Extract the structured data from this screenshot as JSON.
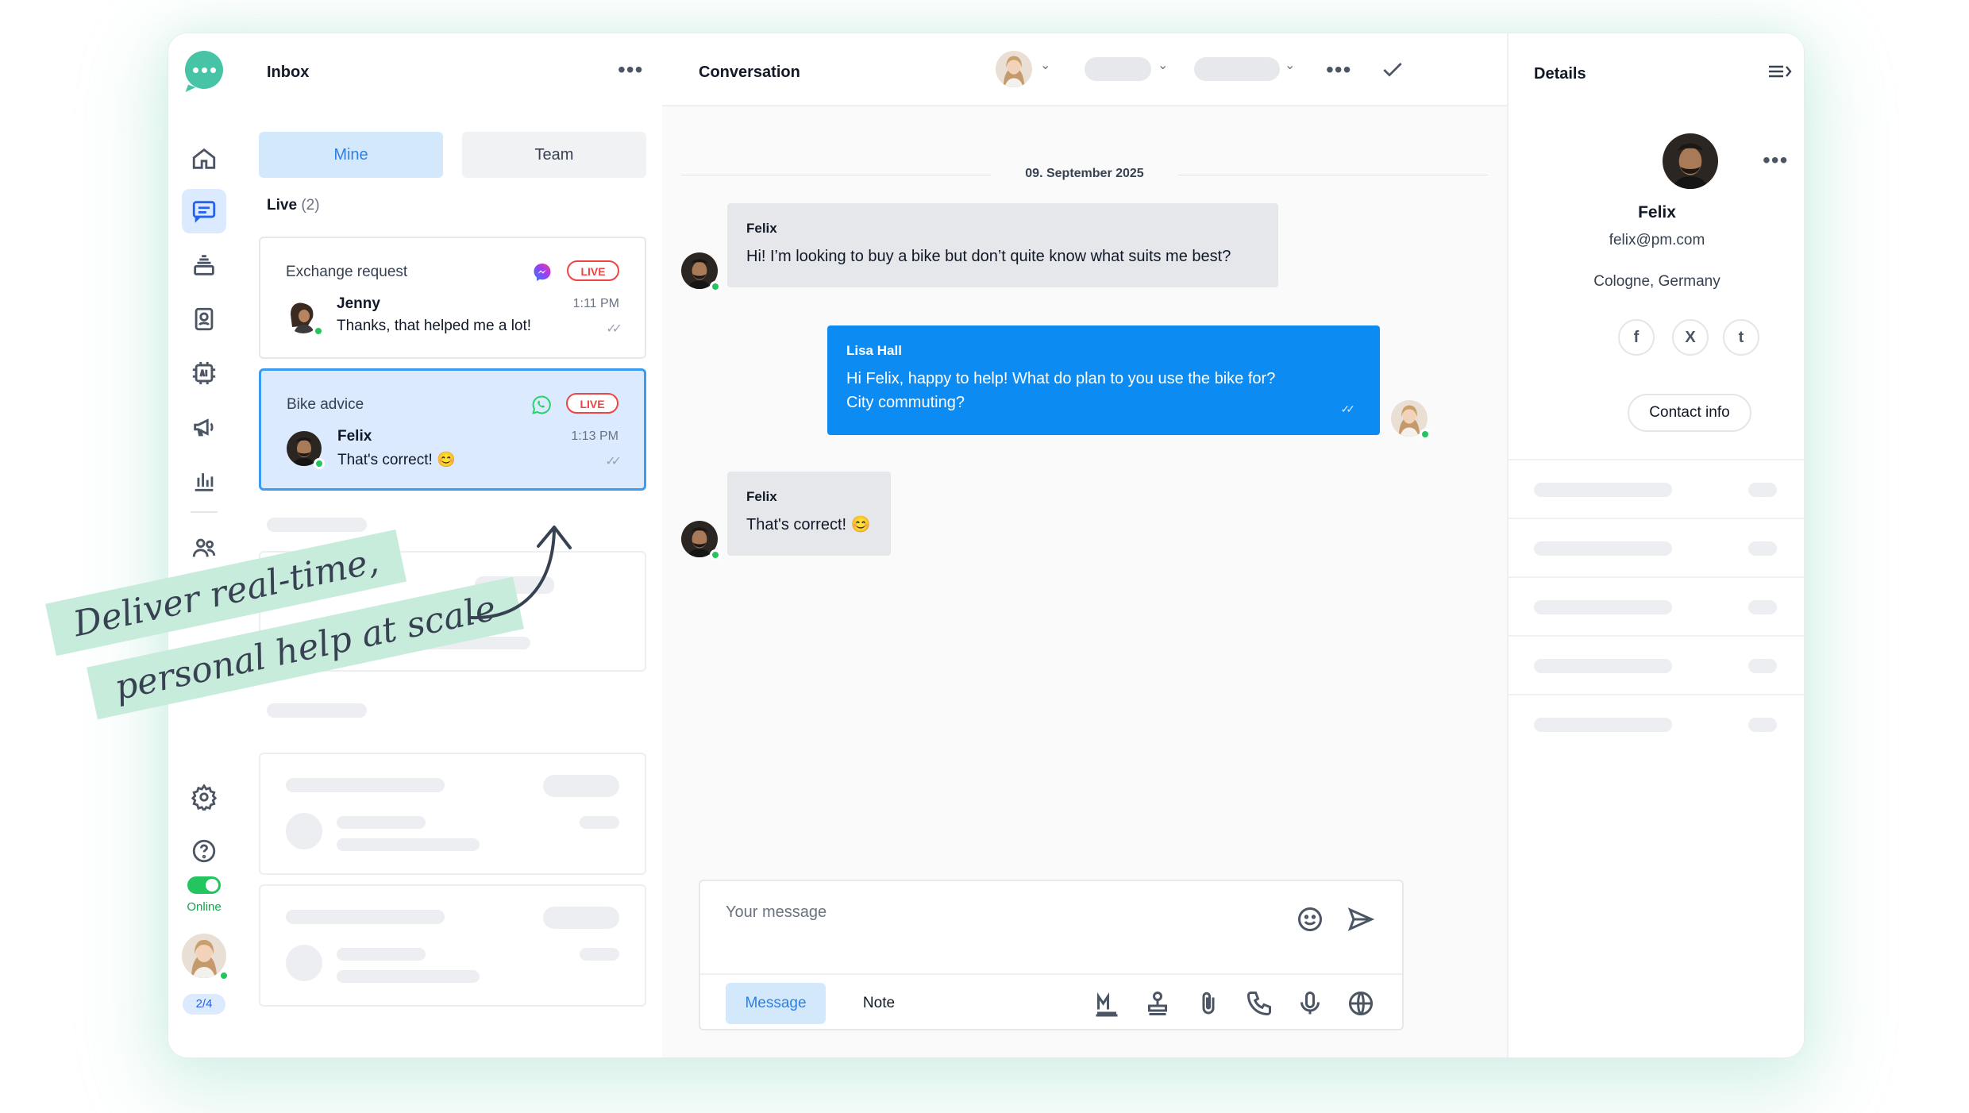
{
  "nav": {
    "items": [
      "home-icon",
      "conversations-icon",
      "inbox-stack-icon",
      "contacts-icon",
      "ai-chip-icon",
      "campaigns-icon",
      "analytics-icon",
      "team-icon",
      "settings-icon",
      "help-icon"
    ],
    "status_label": "Online",
    "agent_count": "2/4",
    "accent": "#2563eb",
    "online_color": "#22c55e"
  },
  "inbox": {
    "title": "Inbox",
    "tabs": {
      "mine": "Mine",
      "team": "Team"
    },
    "section_label": "Live",
    "section_count": "(2)",
    "cards": [
      {
        "subject": "Exchange request",
        "channel": "messenger-icon",
        "badge": "LIVE",
        "name": "Jenny",
        "time": "1:11 PM",
        "message": "Thanks, that helped me a lot!"
      },
      {
        "subject": "Bike advice",
        "channel": "whatsapp-icon",
        "badge": "LIVE",
        "name": "Felix",
        "time": "1:13 PM",
        "message": "That's correct! 😊"
      }
    ]
  },
  "conversation": {
    "title": "Conversation",
    "date": "09. September 2025",
    "messages": [
      {
        "sender": "Felix",
        "text": "Hi! I’m looking to buy a bike but don’t quite know what suits me best?"
      },
      {
        "sender": "Lisa Hall",
        "line1": "Hi Felix, happy to help! What do plan to you use the bike for?",
        "line2": "City commuting?"
      },
      {
        "sender": "Felix",
        "text": "That's correct! 😊"
      }
    ],
    "composer": {
      "placeholder": "Your message",
      "mode_message": "Message",
      "mode_note": "Note"
    },
    "bubble_color": "#0c8cf2"
  },
  "details": {
    "title": "Details",
    "name": "Felix",
    "email": "felix@pm.com",
    "location": "Cologne, Germany",
    "social": [
      "f",
      "X",
      "t"
    ],
    "contact_button": "Contact info"
  },
  "callout": {
    "line1": "Deliver real-time,",
    "line2": "personal help at scale",
    "color": "#c7ecdc"
  }
}
